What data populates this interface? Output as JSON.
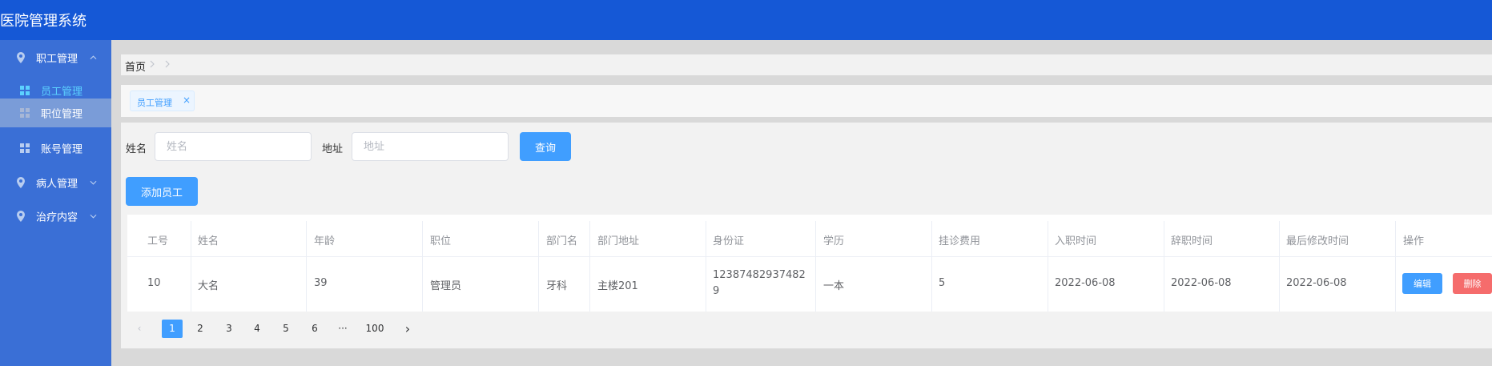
{
  "app": {
    "title": "医院管理系统"
  },
  "sidebar": {
    "groups": [
      {
        "label": "职工管理",
        "icon": "location-pin-icon",
        "expanded": true,
        "items": [
          {
            "label": "员工管理",
            "icon": "grid-icon",
            "state": "active"
          },
          {
            "label": "职位管理",
            "icon": "grid-icon",
            "state": "hover"
          },
          {
            "label": "账号管理",
            "icon": "grid-icon",
            "state": "normal"
          }
        ]
      },
      {
        "label": "病人管理",
        "icon": "location-pin-icon",
        "expanded": false
      },
      {
        "label": "治疗内容",
        "icon": "location-pin-icon",
        "expanded": false
      }
    ]
  },
  "breadcrumb": {
    "home": "首页"
  },
  "tabs": [
    {
      "label": "员工管理",
      "closable": true
    }
  ],
  "search": {
    "name_label": "姓名",
    "name_placeholder": "姓名",
    "address_label": "地址",
    "address_placeholder": "地址",
    "query_button": "查询"
  },
  "actions": {
    "add_button": "添加员工"
  },
  "table": {
    "columns": [
      "工号",
      "姓名",
      "年龄",
      "职位",
      "部门名",
      "部门地址",
      "身份证",
      "学历",
      "挂诊费用",
      "入职时间",
      "辞职时间",
      "最后修改时间",
      "操作"
    ],
    "rows": [
      {
        "id": "10",
        "name": "大名",
        "age": "39",
        "position": "管理员",
        "dept": "牙科",
        "dept_addr": "主楼201",
        "id_card_line1": "12387482937482",
        "id_card_line2": "9",
        "education": "一本",
        "fee": "5",
        "hire_date": "2022-06-08",
        "resign_date": "2022-06-08",
        "modified": "2022-06-08",
        "edit": "编辑",
        "delete": "删除"
      }
    ]
  },
  "pagination": {
    "prev": "‹",
    "pages": [
      "1",
      "2",
      "3",
      "4",
      "5",
      "6"
    ],
    "ellipsis": "···",
    "last": "100",
    "next": "›",
    "current": "1"
  },
  "colors": {
    "header": "#1558d6",
    "sidebar": "#3a6fd6",
    "primary": "#409eff",
    "danger": "#f56c6c",
    "active_menu_text": "#5cd1ff"
  }
}
